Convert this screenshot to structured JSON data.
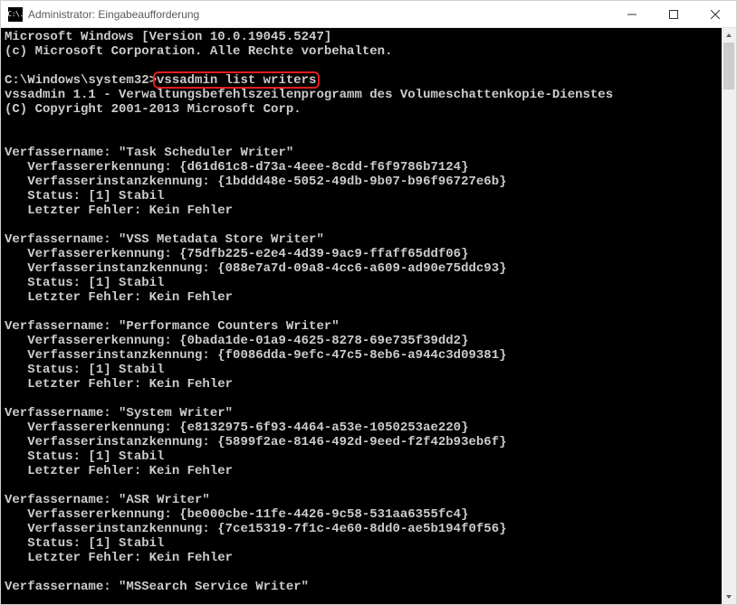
{
  "window": {
    "title": "Administrator: Eingabeaufforderung",
    "icon_label": "C:\\."
  },
  "terminal": {
    "header1": "Microsoft Windows [Version 10.0.19045.5247]",
    "header2": "(c) Microsoft Corporation. Alle Rechte vorbehalten.",
    "prompt_path": "C:\\Windows\\system32>",
    "command": "vssadmin list writers",
    "out1": "vssadmin 1.1 - Verwaltungsbefehlszeilenprogramm des Volumeschattenkopie-Dienstes",
    "out2": "(C) Copyright 2001-2013 Microsoft Corp.",
    "labels": {
      "writer_name": "Verfassername:",
      "writer_id": "Verfassererkennung:",
      "instance_id": "Verfasserinstanzkennung:",
      "status": "Status:",
      "status_val": "[1] Stabil",
      "last_error": "Letzter Fehler:",
      "last_error_val": "Kein Fehler"
    },
    "writers": [
      {
        "name": "Task Scheduler Writer",
        "id": "{d61d61c8-d73a-4eee-8cdd-f6f9786b7124}",
        "instance": "{1bddd48e-5052-49db-9b07-b96f96727e6b}"
      },
      {
        "name": "VSS Metadata Store Writer",
        "id": "{75dfb225-e2e4-4d39-9ac9-ffaff65ddf06}",
        "instance": "{088e7a7d-09a8-4cc6-a609-ad90e75ddc93}"
      },
      {
        "name": "Performance Counters Writer",
        "id": "{0bada1de-01a9-4625-8278-69e735f39dd2}",
        "instance": "{f0086dda-9efc-47c5-8eb6-a944c3d09381}"
      },
      {
        "name": "System Writer",
        "id": "{e8132975-6f93-4464-a53e-1050253ae220}",
        "instance": "{5899f2ae-8146-492d-9eed-f2f42b93eb6f}"
      },
      {
        "name": "ASR Writer",
        "id": "{be000cbe-11fe-4426-9c58-531aa6355fc4}",
        "instance": "{7ce15319-7f1c-4e60-8dd0-ae5b194f0f56}"
      },
      {
        "name": "MSSearch Service Writer",
        "id": "",
        "instance": ""
      }
    ]
  }
}
